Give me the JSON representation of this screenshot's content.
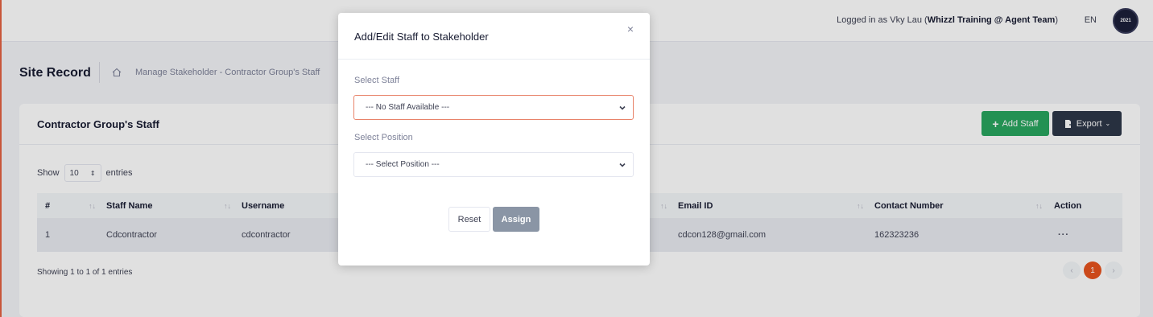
{
  "topbar": {
    "login_prefix": "Logged in as Vky Lau (",
    "login_org": "Whizzl Training @ Agent Team",
    "login_suffix": ")",
    "language": "EN",
    "avatar_text": "2021"
  },
  "subheader": {
    "title": "Site Record",
    "breadcrumb": "Manage Stakeholder  -  Contractor Group's Staff"
  },
  "card": {
    "title": "Contractor Group's Staff",
    "add_staff_label": "Add Staff",
    "export_label": "Export",
    "show_label": "Show",
    "entries_value": "10",
    "entries_label": "entries",
    "columns": [
      "#",
      "Staff Name",
      "Username",
      "Email ID",
      "Contact Number",
      "Action"
    ],
    "rows": [
      {
        "index": "1",
        "staff_name": "Cdcontractor",
        "username": "cdcontractor",
        "email": "cdcon128@gmail.com",
        "contact": "162323236",
        "action": "···"
      }
    ],
    "info": "Showing 1 to 1 of 1 entries",
    "pages": [
      "‹",
      "1",
      "›"
    ]
  },
  "modal": {
    "title": "Add/Edit Staff to Stakeholder",
    "close": "×",
    "staff_label": "Select Staff",
    "staff_value": "--- No Staff Available ---",
    "position_label": "Select Position",
    "position_value": "--- Select Position ---",
    "reset_label": "Reset",
    "assign_label": "Assign"
  },
  "colors": {
    "accent": "#e8541e",
    "add_button": "#28a55f",
    "export_button": "#2d3748",
    "assign_button": "#8a95a5"
  }
}
